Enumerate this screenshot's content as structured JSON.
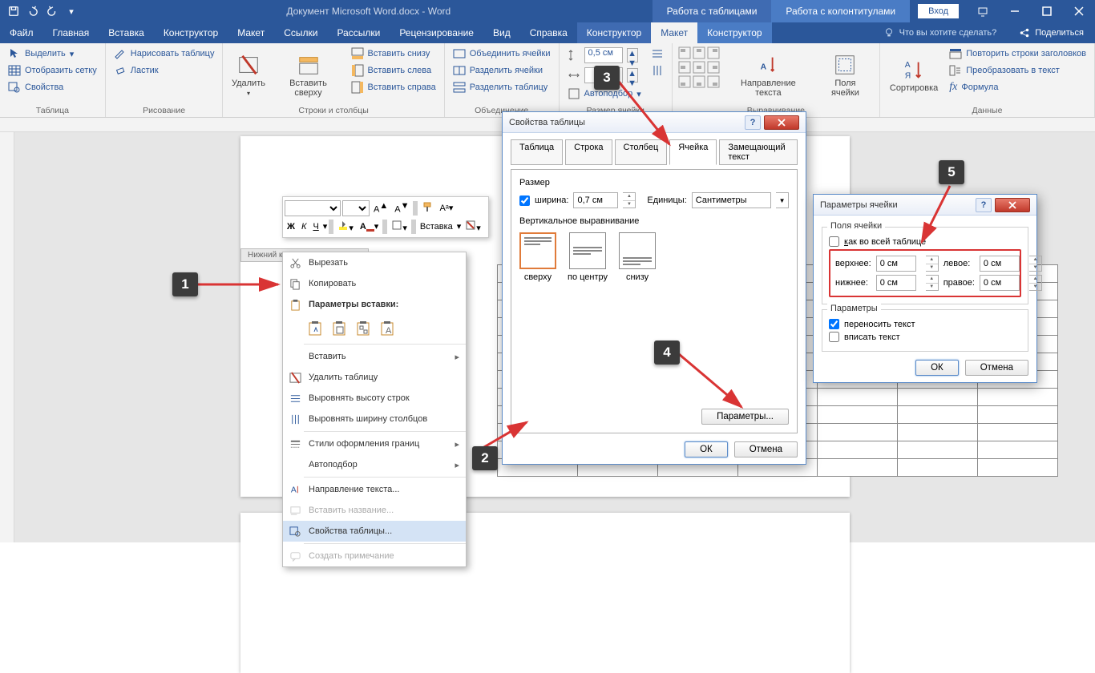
{
  "titlebar": {
    "doc_title": "Документ Microsoft Word.docx - Word",
    "context1": "Работа с таблицами",
    "context2": "Работа с колонтитулами",
    "login": "Вход"
  },
  "tabs": {
    "file": "Файл",
    "home": "Главная",
    "insert": "Вставка",
    "design": "Конструктор",
    "layout": "Макет",
    "references": "Ссылки",
    "mailings": "Рассылки",
    "review": "Рецензирование",
    "view": "Вид",
    "help": "Справка",
    "table_design": "Конструктор",
    "table_layout": "Макет",
    "header_design": "Конструктор",
    "tell_me": "Что вы хотите сделать?",
    "share": "Поделиться"
  },
  "ribbon": {
    "select": "Выделить",
    "gridlines": "Отобразить сетку",
    "properties": "Свойства",
    "group_table": "Таблица",
    "draw": "Нарисовать таблицу",
    "eraser": "Ластик",
    "group_draw": "Рисование",
    "delete": "Удалить",
    "insert_above": "Вставить сверху",
    "insert_below": "Вставить снизу",
    "insert_left": "Вставить слева",
    "insert_right": "Вставить справа",
    "group_rows": "Строки и столбцы",
    "merge": "Объединить ячейки",
    "split": "Разделить ячейки",
    "split_table": "Разделить таблицу",
    "group_merge": "Объединение",
    "height_val": "0,5 см",
    "autofit": "Автоподбор",
    "group_size": "Размер ячейки",
    "text_dir": "Направление текста",
    "cell_margins": "Поля ячейки",
    "group_align": "Выравнивание",
    "sort": "Сортировка",
    "repeat_header": "Повторить строки заголовков",
    "to_text": "Преобразовать в текст",
    "formula": "Формула",
    "group_data": "Данные"
  },
  "footer_section": "Нижний колонтитул -Раздел 2-",
  "context_menu": {
    "cut": "Вырезать",
    "copy": "Копировать",
    "paste_options": "Параметры вставки:",
    "insert": "Вставить",
    "delete_table": "Удалить таблицу",
    "distribute_rows": "Выровнять высоту строк",
    "distribute_cols": "Выровнять ширину столбцов",
    "border_styles": "Стили оформления границ",
    "autofit": "Автоподбор",
    "text_direction": "Направление текста...",
    "insert_caption": "Вставить название...",
    "table_properties": "Свойства таблицы...",
    "new_comment": "Создать примечание"
  },
  "mini_toolbar": {
    "bold": "Ж",
    "italic": "К",
    "insert": "Вставка"
  },
  "dialog1": {
    "title": "Свойства таблицы",
    "tab_table": "Таблица",
    "tab_row": "Строка",
    "tab_column": "Столбец",
    "tab_cell": "Ячейка",
    "tab_alt": "Замещающий текст",
    "size_label": "Размер",
    "width_label": "ширина:",
    "width_val": "0,7 см",
    "units_label": "Единицы:",
    "units_val": "Сантиметры",
    "valign_label": "Вертикальное выравнивание",
    "align_top": "сверху",
    "align_center": "по центру",
    "align_bottom": "снизу",
    "params_btn": "Параметры...",
    "ok": "ОК",
    "cancel": "Отмена"
  },
  "dialog2": {
    "title": "Параметры ячейки",
    "margins_label": "Поля ячейки",
    "same_as_table": "как во всей таблице",
    "top": "верхнее:",
    "bottom": "нижнее:",
    "left": "левое:",
    "right": "правое:",
    "val": "0 см",
    "options_label": "Параметры",
    "wrap": "переносить текст",
    "fit": "вписать текст",
    "ok": "ОК",
    "cancel": "Отмена"
  },
  "steps": {
    "1": "1",
    "2": "2",
    "3": "3",
    "4": "4",
    "5": "5"
  }
}
